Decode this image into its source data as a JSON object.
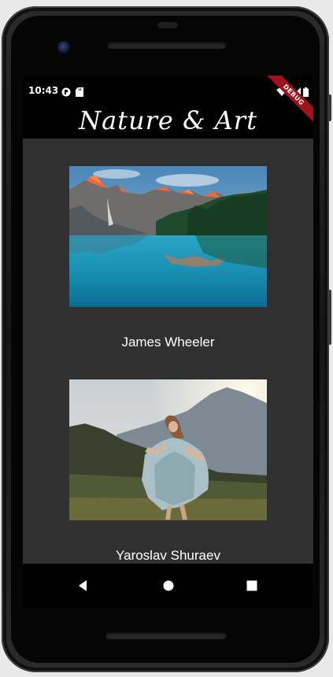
{
  "status_bar": {
    "time": "10:43"
  },
  "debug_banner": "DEBUG",
  "app_bar": {
    "title": "Nature & Art"
  },
  "cards": [
    {
      "label": "James Wheeler",
      "image": "mountain-lake"
    },
    {
      "label": "Yaroslav Shuraev",
      "image": "woman-dancing-mountains"
    }
  ],
  "nav": [
    "back",
    "home",
    "recents"
  ]
}
